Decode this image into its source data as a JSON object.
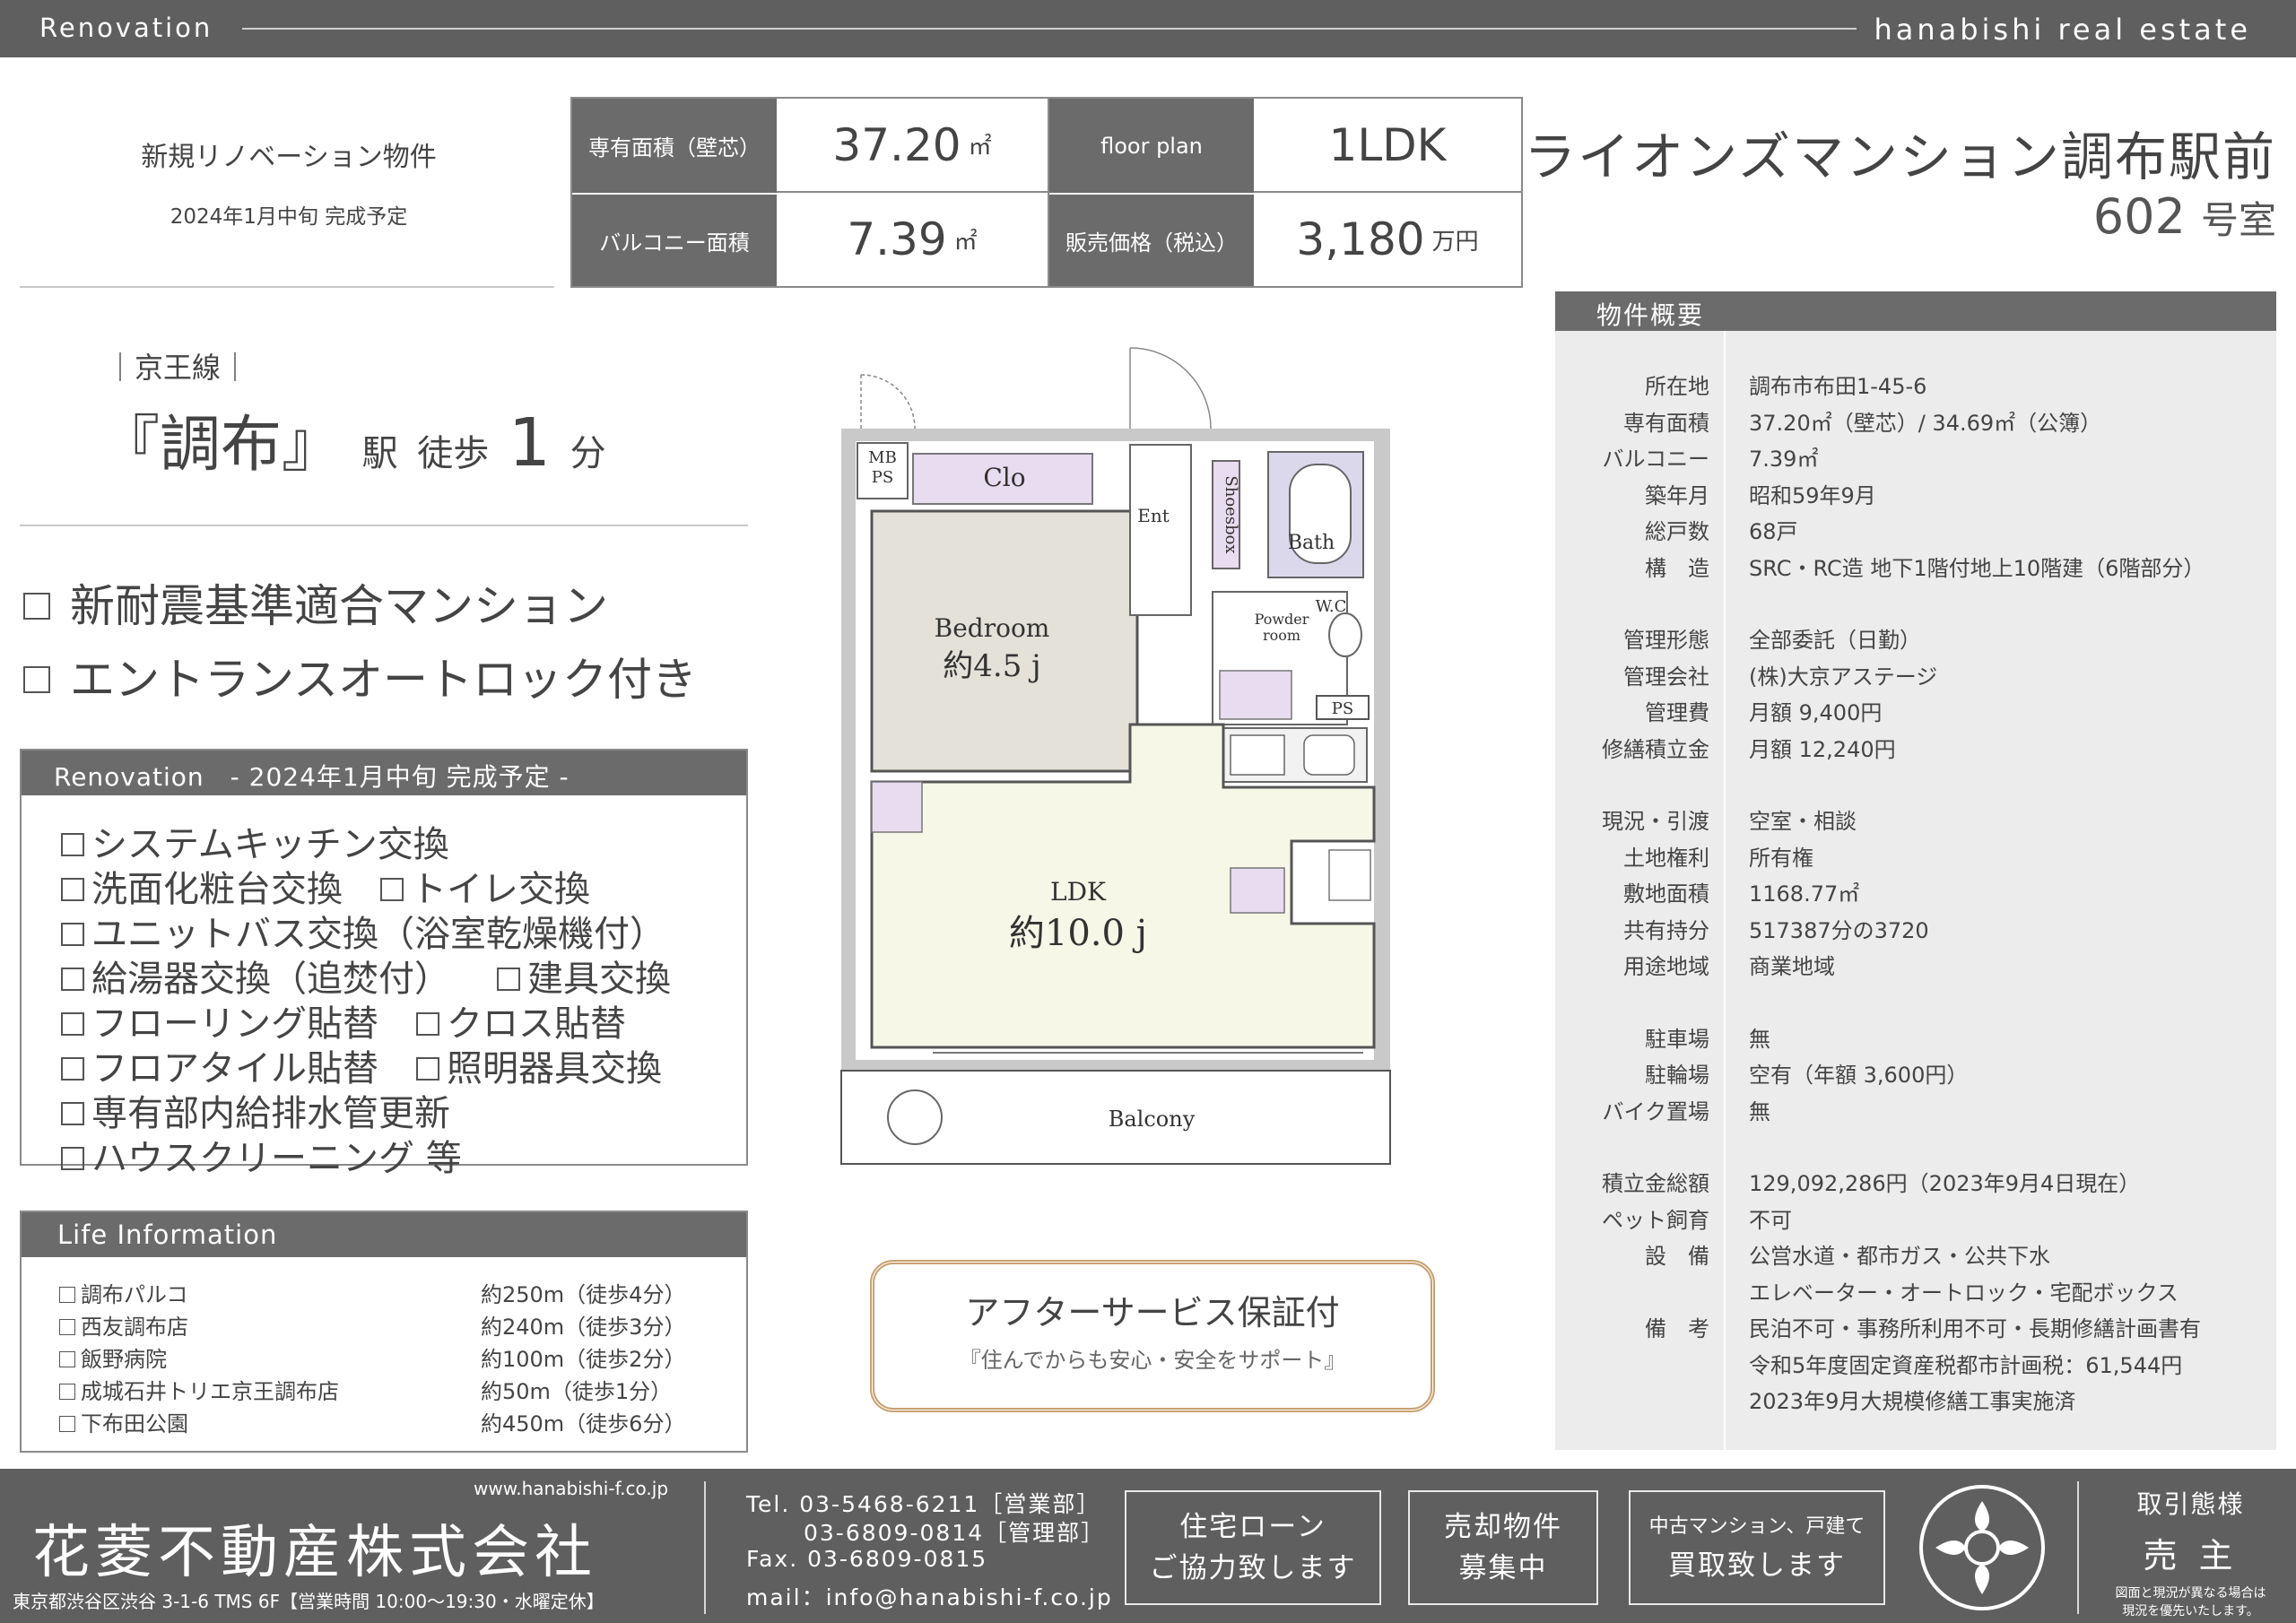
{
  "header": {
    "left": "Renovation",
    "right": "hanabishi real estate"
  },
  "intro": {
    "title": "新規リノベーション物件",
    "completion": "2024年1月中旬 完成予定"
  },
  "spec": {
    "area_label": "専有面積（壁芯）",
    "area_value": "37.20",
    "floorplan_label": "floor plan",
    "floorplan_value": "1LDK",
    "balcony_label": "バルコニー面積",
    "balcony_value": "7.39",
    "price_label": "販売価格（税込）",
    "price_value": "3,180",
    "price_unit": "万円",
    "sqm_unit": "㎡"
  },
  "building": {
    "name": "ライオンズマンション調布駅前",
    "room_number": "602",
    "room_unit": "号室"
  },
  "station": {
    "line": "｜京王線｜",
    "open": "『",
    "name": "調布",
    "close": "』",
    "eki": "駅",
    "walk": "徒歩",
    "minutes": "1",
    "minutes_unit": "分"
  },
  "features": [
    "新耐震基準適合マンション",
    "エントランスオートロック付き"
  ],
  "renovation": {
    "header": "Renovation　- 2024年1月中旬 完成予定 -",
    "items": [
      [
        "システムキッチン交換"
      ],
      [
        "洗面化粧台交換",
        "トイレ交換"
      ],
      [
        "ユニットバス交換（浴室乾燥機付）"
      ],
      [
        "給湯器交換（追焚付）",
        "建具交換"
      ],
      [
        "フローリング貼替",
        "クロス貼替"
      ],
      [
        "フロアタイル貼替",
        "照明器具交換"
      ],
      [
        "専有部内給排水管更新"
      ],
      [
        "ハウスクリーニング 等"
      ]
    ]
  },
  "life": {
    "header": "Life Information",
    "items": [
      {
        "name": "調布パルコ",
        "distance": "約250m（徒歩4分）"
      },
      {
        "name": "西友調布店",
        "distance": "約240m（徒歩3分）"
      },
      {
        "name": "飯野病院",
        "distance": "約100m（徒歩2分）"
      },
      {
        "name": "成城石井トリエ京王調布店",
        "distance": "約50m（徒歩1分）"
      },
      {
        "name": "下布田公園",
        "distance": "約450m（徒歩6分）"
      }
    ]
  },
  "floorplan": {
    "mbps_1": "MB",
    "mbps_2": "PS",
    "clo": "Clo",
    "ent": "Ent",
    "shoesbox": "Shoesbox",
    "bath": "Bath",
    "powder_1": "Powder",
    "powder_2": "room",
    "wc": "W.C",
    "ps": "PS",
    "bedroom": "Bedroom",
    "bedroom_size": "約4.5 j",
    "ldk": "LDK",
    "ldk_size": "約10.0 j",
    "balcony": "Balcony"
  },
  "summary": {
    "header": "物件概要",
    "rows": [
      {
        "k": "所在地",
        "v": "調布市布田1-45-6"
      },
      {
        "k": "専有面積",
        "v": "37.20㎡（壁芯）/ 34.69㎡（公簿）"
      },
      {
        "k": "バルコニー",
        "v": "7.39㎡"
      },
      {
        "k": "築年月",
        "v": "昭和59年9月"
      },
      {
        "k": "総戸数",
        "v": "68戸"
      },
      {
        "k": "構　造",
        "v": "SRC・RC造 地下1階付地上10階建（6階部分）"
      },
      {
        "k": "管理形態",
        "v": "全部委託（日勤）"
      },
      {
        "k": "管理会社",
        "v": "(株)大京アステージ"
      },
      {
        "k": "管理費",
        "v": "月額 9,400円"
      },
      {
        "k": "修繕積立金",
        "v": "月額 12,240円"
      },
      {
        "k": "現況・引渡",
        "v": "空室・相談"
      },
      {
        "k": "土地権利",
        "v": "所有権"
      },
      {
        "k": "敷地面積",
        "v": "1168.77㎡"
      },
      {
        "k": "共有持分",
        "v": "517387分の3720"
      },
      {
        "k": "用途地域",
        "v": "商業地域"
      },
      {
        "k": "駐車場",
        "v": "無"
      },
      {
        "k": "駐輪場",
        "v": "空有（年額 3,600円）"
      },
      {
        "k": "バイク置場",
        "v": "無"
      },
      {
        "k": "積立金総額",
        "v": "129,092,286円（2023年9月4日現在）"
      },
      {
        "k": "ペット飼育",
        "v": "不可"
      },
      {
        "k": "設　備",
        "v": "公営水道・都市ガス・公共下水"
      },
      {
        "k": "",
        "v": "エレベーター・オートロック・宅配ボックス"
      },
      {
        "k": "備　考",
        "v": "民泊不可・事務所利用不可・長期修繕計画書有"
      },
      {
        "k": "",
        "v": "令和5年度固定資産税都市計画税：61,544円"
      },
      {
        "k": "",
        "v": "2023年9月大規模修繕工事実施済"
      }
    ]
  },
  "after_service": {
    "title": "アフターサービス保証付",
    "subtitle": "『住んでからも安心・安全をサポート』"
  },
  "footer": {
    "url": "www.hanabishi-f.co.jp",
    "company": "花菱不動産株式会社",
    "address": "東京都渋谷区渋谷 3-1-6 TMS 6F【営業時間 10:00～19:30・水曜定休】",
    "tel_line": "Tel. 03-5468-6211［営業部］",
    "tel2_line": "03-6809-0814［管理部］",
    "fax_line": "Fax. 03-6809-0815",
    "mail_line": "mail：info@hanabishi-f.co.jp",
    "btn_loan_1": "住宅ローン",
    "btn_loan_2": "ご協力致します",
    "btn_sell_1": "売却物件",
    "btn_sell_2": "募集中",
    "btn_buy_1": "中古マンション、戸建て",
    "btn_buy_2": "買取致します",
    "torihiki": "取引態様",
    "torihiki_value": "売 主",
    "note_1": "図面と現況が異なる場合は",
    "note_2": "現況を優先いたします。"
  }
}
